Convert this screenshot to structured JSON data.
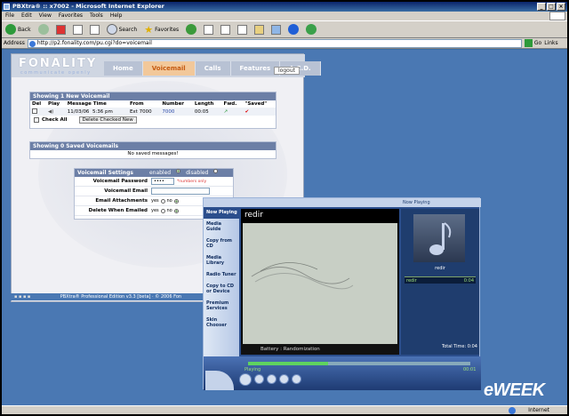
{
  "window": {
    "title": "PBXtra® :: x7002 - Microsoft Internet Explorer",
    "buttons": [
      "_",
      "□",
      "×"
    ]
  },
  "menu": [
    "File",
    "Edit",
    "View",
    "Favorites",
    "Tools",
    "Help"
  ],
  "toolbar": {
    "back": "Back",
    "search": "Search",
    "favorites": "Favorites"
  },
  "address": {
    "label": "Address",
    "url": "http://p2.fonality.com/pu.cgi?do=voicemail",
    "go": "Go",
    "links": "Links"
  },
  "fonality": {
    "logo": "FONALITY",
    "tagline": "communicate openly",
    "tabs": [
      "Home",
      "Voicemail",
      "Calls",
      "Features",
      "A.C.D."
    ],
    "active_tab": "Voicemail",
    "logout": "logout",
    "new_vm": {
      "heading": "Showing 1 New Voicemail",
      "columns": [
        "Del",
        "Play",
        "Message Time",
        "From",
        "Number",
        "Length",
        "Fwd.",
        "\"Saved\""
      ],
      "row": {
        "date": "11/03/06",
        "time": "5:36 pm",
        "from": "Ext 7000",
        "number": "7000",
        "length": "00:05",
        "fwd": "↗",
        "saved": "✔"
      },
      "check_all": "Check All",
      "delete_checked": "Delete Checked New"
    },
    "saved_vm": {
      "heading": "Showing 0 Saved Voicemails",
      "empty": "No saved messages!"
    },
    "settings": {
      "heading": "Voicemail Settings",
      "enabled": "enabled",
      "disabled": "disabled",
      "password_label": "Voicemail Password",
      "password_value": "••••",
      "password_hint": "*numbers only",
      "email_label": "Voicemail Email",
      "attach_label": "Email Attachments",
      "delete_label": "Delete When Emailed",
      "yes": "yes",
      "no": "no"
    },
    "footer": "PBXtra® Professional Edition v3.3 [beta]  ·  © 2006 Fon"
  },
  "wmp": {
    "now_playing_tab": "Now Playing",
    "sidebar": [
      "Now Playing",
      "Media Guide",
      "Copy from CD",
      "Media Library",
      "Radio Tuner",
      "Copy to CD or Device",
      "Premium Services",
      "Skin Chooser"
    ],
    "song_title": "redir",
    "info_text": "Battery : Randomization",
    "art_label": "redir",
    "playlist_item": "redir",
    "playlist_time": "0:04",
    "total_time": "Total Time: 0:04",
    "status": "Playing",
    "status_time": "00:01",
    "progress": 0.36
  },
  "statusbar": {
    "zone": "Internet"
  },
  "watermark": "eWEEK"
}
